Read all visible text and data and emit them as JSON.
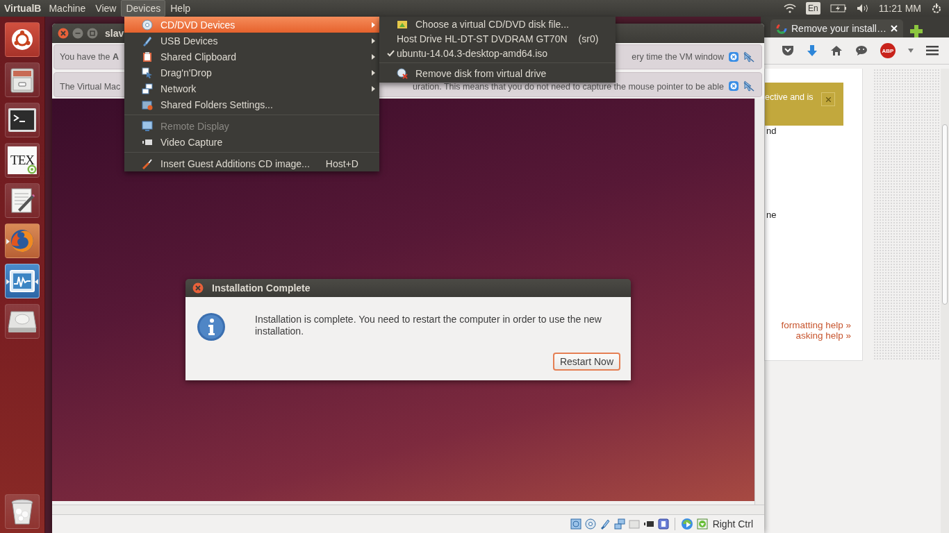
{
  "top_panel": {
    "app_name": "VirtualB",
    "menus": [
      {
        "label": "Machine",
        "selected": false
      },
      {
        "label": "View",
        "selected": false
      },
      {
        "label": "Devices",
        "selected": true
      },
      {
        "label": "Help",
        "selected": false
      }
    ],
    "keyboard_layout": "En",
    "clock": "11:21 MM"
  },
  "launcher": {
    "items": [
      {
        "kind": "ubuntu",
        "running": false,
        "focused": false
      },
      {
        "kind": "files",
        "running": false,
        "focused": false
      },
      {
        "kind": "terminal",
        "running": false,
        "focused": false
      },
      {
        "kind": "tex",
        "logo_text": "TEX",
        "running": false,
        "focused": false
      },
      {
        "kind": "editor",
        "running": false,
        "focused": false
      },
      {
        "kind": "firefox",
        "running": true,
        "focused": false
      },
      {
        "kind": "monitor",
        "running": true,
        "focused": true
      },
      {
        "kind": "disk",
        "running": false,
        "focused": false
      },
      {
        "kind": "trash",
        "running": false,
        "focused": false
      }
    ]
  },
  "browser": {
    "tab_title": "Remove your install…",
    "adblock_label": "ABP",
    "banner_text": "ective and is",
    "fragments": [
      "nd",
      "ne"
    ],
    "links": [
      "formatting help »",
      "asking help »"
    ]
  },
  "vm_window": {
    "title": "slav",
    "notices": [
      {
        "left": "You have the **A**",
        "right": "ery time the VM window"
      },
      {
        "left": "The Virtual Mac",
        "right": "uration. This means that you do not need to capture the mouse pointer to be able"
      }
    ],
    "host_key": "Right Ctrl"
  },
  "guest_dialog": {
    "title": "Installation Complete",
    "message": "Installation is complete. You need to restart the computer in order to use the new installation.",
    "button": "Restart Now"
  },
  "devices_menu": {
    "items": [
      {
        "kind": "item",
        "label": "CD/DVD Devices",
        "submenu": true,
        "selected": true,
        "disabled": false
      },
      {
        "kind": "item",
        "label": "USB Devices",
        "submenu": true,
        "selected": false,
        "disabled": false
      },
      {
        "kind": "item",
        "label": "Shared Clipboard",
        "submenu": true,
        "selected": false,
        "disabled": false
      },
      {
        "kind": "item",
        "label": "Drag'n'Drop",
        "submenu": true,
        "selected": false,
        "disabled": false
      },
      {
        "kind": "item",
        "label": "Network",
        "submenu": true,
        "selected": false,
        "disabled": false
      },
      {
        "kind": "item",
        "label": "Shared Folders Settings...",
        "submenu": false,
        "selected": false,
        "disabled": false
      },
      {
        "kind": "separator"
      },
      {
        "kind": "item",
        "label": "Remote Display",
        "submenu": false,
        "selected": false,
        "disabled": true
      },
      {
        "kind": "item",
        "label": "Video Capture",
        "submenu": false,
        "selected": false,
        "disabled": false
      },
      {
        "kind": "separator"
      },
      {
        "kind": "item",
        "label": "Insert Guest Additions CD image...",
        "shortcut": "Host+D",
        "submenu": false,
        "selected": false,
        "disabled": false
      }
    ]
  },
  "cd_submenu": {
    "items": [
      {
        "kind": "action",
        "label": "Choose a virtual CD/DVD disk file..."
      },
      {
        "kind": "drive",
        "label": "Host Drive HL-DT-ST DVDRAM GT70N",
        "detail": "(sr0)",
        "checked": false
      },
      {
        "kind": "drive",
        "label": "ubuntu-14.04.3-desktop-amd64.iso",
        "checked": true
      },
      {
        "kind": "separator"
      },
      {
        "kind": "action",
        "label": "Remove disk from virtual drive"
      }
    ]
  }
}
